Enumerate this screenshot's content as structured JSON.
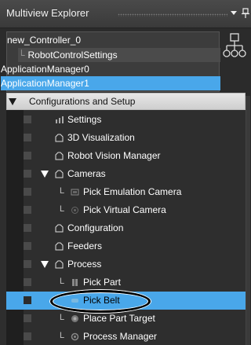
{
  "window": {
    "title": "Multiview Explorer"
  },
  "controllers": [
    {
      "label": "new_Controller_0",
      "kind": "plain"
    },
    {
      "label": "RobotControlSettings",
      "kind": "sub",
      "lead": "└"
    },
    {
      "label": "ApplicationManager0",
      "kind": "plain"
    },
    {
      "label": "ApplicationManager1",
      "kind": "selected"
    }
  ],
  "tree": {
    "root": "Configurations and Setup",
    "items": [
      {
        "label": "Settings",
        "icon": "gear-icon"
      },
      {
        "label": "3D Visualization",
        "icon": "folder-icon"
      },
      {
        "label": "Robot Vision Manager",
        "icon": "folder-icon"
      },
      {
        "label": "Cameras",
        "icon": "folder-icon",
        "expanded": true
      },
      {
        "label": "Pick Emulation Camera",
        "icon": "camera-icon",
        "branch": "L"
      },
      {
        "label": "Pick Virtual Camera",
        "icon": "virtual-camera-icon",
        "branch": "L"
      },
      {
        "label": "Configuration",
        "icon": "folder-icon"
      },
      {
        "label": "Feeders",
        "icon": "folder-icon"
      },
      {
        "label": "Process",
        "icon": "folder-icon",
        "expanded": true
      },
      {
        "label": "Pick Part",
        "icon": "part-icon",
        "branch": "L"
      },
      {
        "label": "Pick Belt",
        "icon": "belt-icon",
        "selected": true
      },
      {
        "label": "Place Part Target",
        "icon": "target-icon",
        "branch": "L"
      },
      {
        "label": "Process Manager",
        "icon": "manager-icon",
        "branch": "L"
      }
    ]
  },
  "colors": {
    "selection": "#49a7ea",
    "panel": "#3c3c3c",
    "background": "#2e2e2e"
  }
}
